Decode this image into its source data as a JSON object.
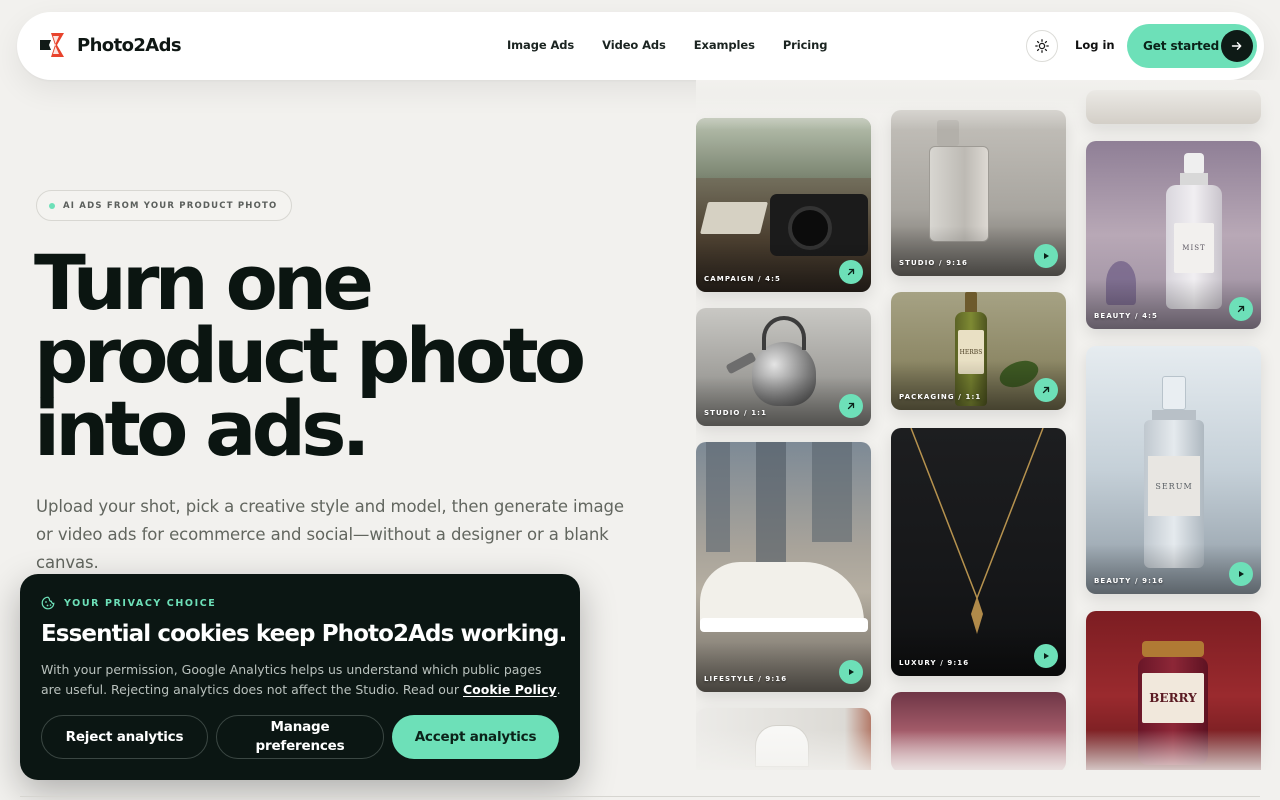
{
  "brand": {
    "name": "Photo2Ads",
    "accent": "#6de0b8",
    "dark": "#0b1613",
    "logo_red": "#e8432c"
  },
  "nav": {
    "items": [
      {
        "label": "Image Ads"
      },
      {
        "label": "Video Ads"
      },
      {
        "label": "Examples"
      },
      {
        "label": "Pricing"
      }
    ],
    "theme_icon": "sun-icon",
    "login_label": "Log in",
    "cta_label": "Get started"
  },
  "hero": {
    "eyebrow": "AI ADS FROM YOUR PRODUCT PHOTO",
    "headline_line1": "Turn one",
    "headline_line2": "product photo",
    "headline_line3": "into ads.",
    "subtext": "Upload your shot, pick a creative style and model, then generate image or video ads for ecommerce and social—without a designer or a blank canvas."
  },
  "gallery": {
    "tiles": [
      {
        "label": "CAMPAIGN / 4:5",
        "action": "arrow-icon",
        "subject": "camera"
      },
      {
        "label": "STUDIO / 1:1",
        "action": "arrow-icon",
        "subject": "kettle"
      },
      {
        "label": "LIFESTYLE / 9:16",
        "action": "play-icon",
        "subject": "sneaker"
      },
      {
        "label": "STUDIO / 9:16",
        "action": "play-icon",
        "subject": "perfume-bottle"
      },
      {
        "label": "PACKAGING / 1:1",
        "action": "arrow-icon",
        "subject": "herbs-bottle",
        "bottle_text": "HERBS"
      },
      {
        "label": "LUXURY / 9:16",
        "action": "play-icon",
        "subject": "necklace"
      },
      {
        "label": "BEAUTY / 4:5",
        "action": "arrow-icon",
        "subject": "mist-spray",
        "bottle_text": "MIST"
      },
      {
        "label": "BEAUTY / 9:16",
        "action": "play-icon",
        "subject": "serum",
        "bottle_text": "SERUM"
      },
      {
        "label": "",
        "subject": "berry-jar",
        "bottle_text": "BERRY"
      }
    ]
  },
  "cookie": {
    "eyebrow": "YOUR PRIVACY CHOICE",
    "title": "Essential cookies keep Photo2Ads working.",
    "body": "With your permission, Google Analytics helps us understand which public pages are useful. Rejecting analytics does not affect the Studio. Read our",
    "link_label": "Cookie Policy",
    "body_end": ".",
    "reject_label": "Reject analytics",
    "manage_label": "Manage preferences",
    "accept_label": "Accept analytics"
  }
}
